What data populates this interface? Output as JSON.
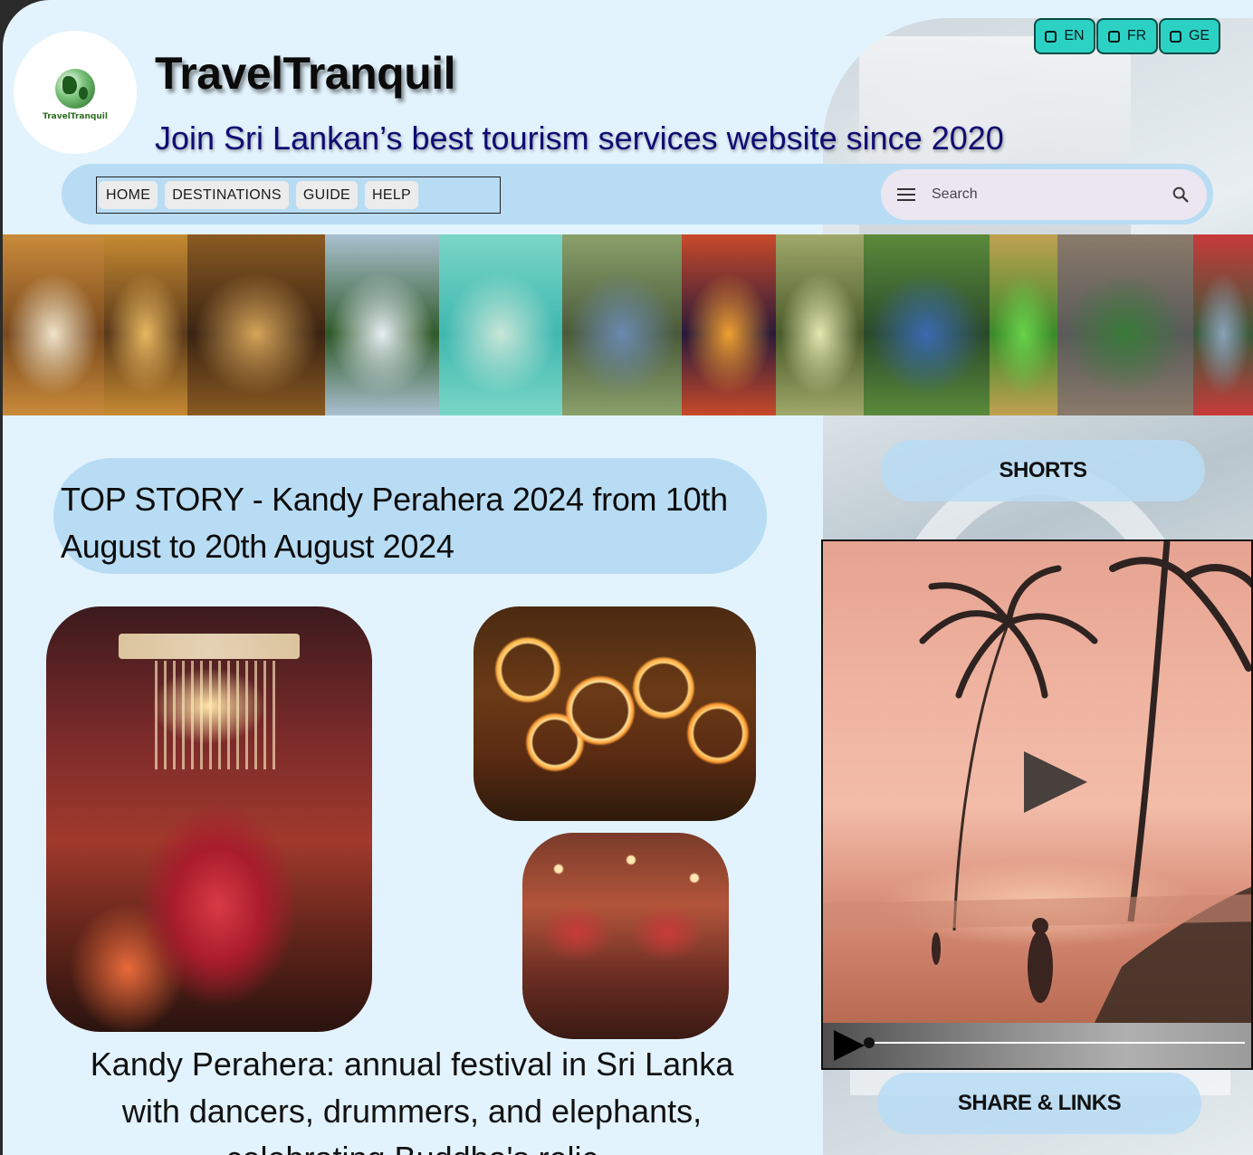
{
  "header": {
    "logo_text": "TravelTranquil",
    "title": "TravelTranquil",
    "tagline": "Join Sri Lankan’s best tourism services website since 2020"
  },
  "languages": [
    {
      "label": "EN",
      "icon": "checkbox-icon"
    },
    {
      "label": "FR",
      "icon": "checkbox-icon"
    },
    {
      "label": "GE",
      "icon": "checkbox-icon"
    }
  ],
  "nav": {
    "items": [
      "HOME",
      "DESTINATIONS",
      "GUIDE",
      "HELP"
    ]
  },
  "search": {
    "placeholder": "Search",
    "menu_icon": "menu-icon",
    "search_icon": "search-icon"
  },
  "strip": {
    "photos": [
      {
        "name": "photo-fish-curry",
        "colors": [
          "#7a4a1e",
          "#c98a3a",
          "#f0e3c8"
        ]
      },
      {
        "name": "photo-masks",
        "colors": [
          "#5a3a1a",
          "#c68a32",
          "#e8b860"
        ]
      },
      {
        "name": "photo-tea-pour",
        "colors": [
          "#3a2412",
          "#8a5a22",
          "#d6a45a"
        ]
      },
      {
        "name": "photo-mountain-flag",
        "colors": [
          "#2f5a2a",
          "#aac0d0",
          "#e8eef4"
        ]
      },
      {
        "name": "photo-turtle-snorkel",
        "colors": [
          "#3fb8b0",
          "#7ad6c6",
          "#c8e6d8"
        ]
      },
      {
        "name": "photo-sigiriya-elephant",
        "colors": [
          "#4a5a3a",
          "#8aa06a",
          "#6a8ab0"
        ]
      },
      {
        "name": "photo-stilt-fishermen",
        "colors": [
          "#2a1a3a",
          "#c84a2a",
          "#f0a030"
        ]
      },
      {
        "name": "photo-lotus-tower-train",
        "colors": [
          "#4a5a2a",
          "#a0a86a",
          "#e4e8b0"
        ]
      },
      {
        "name": "photo-nine-arch-train",
        "colors": [
          "#2a4a2a",
          "#5a8a3a",
          "#3a6ab0"
        ]
      },
      {
        "name": "photo-leopard",
        "colors": [
          "#3a8a2a",
          "#c0a050",
          "#6ad04a"
        ]
      },
      {
        "name": "photo-elephant-tuktuk",
        "colors": [
          "#5a5a5a",
          "#8a7a6a",
          "#3a7a3a"
        ]
      },
      {
        "name": "photo-hot-air-balloon",
        "colors": [
          "#3a5a3a",
          "#c83a3a",
          "#8aa0b8"
        ]
      }
    ]
  },
  "story": {
    "title": "TOP STORY - Kandy Perahera 2024 from 10th August to 20th August 2024",
    "caption": "Kandy Perahera: annual festival in Sri Lanka with dancers, drummers, and elephants, celebrating Buddha's relic"
  },
  "sidebar": {
    "shorts_label": "SHORTS",
    "share_label": "SHARE & LINKS"
  },
  "video": {
    "play_icon": "play-icon",
    "progress": 0.0
  }
}
